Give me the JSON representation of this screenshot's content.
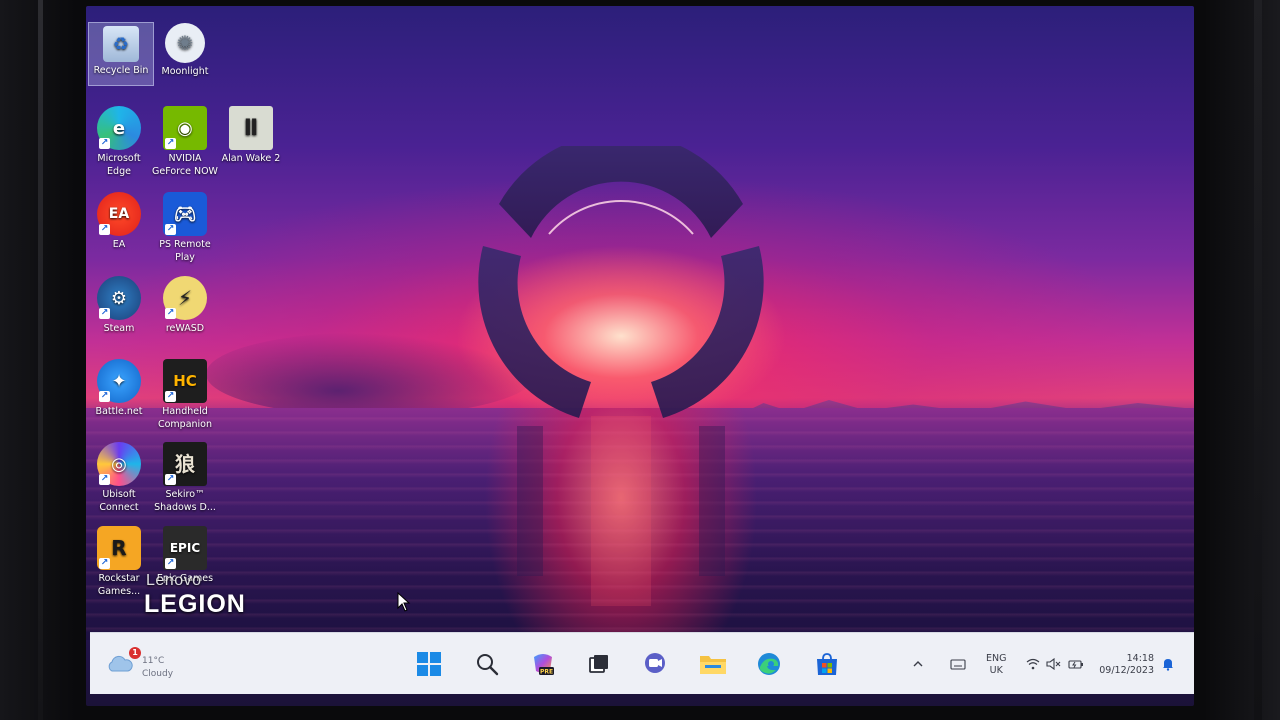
{
  "desktop": {
    "icons": [
      {
        "label": "Recycle Bin",
        "icon": "recycle-bin-icon"
      },
      {
        "label": "Moonlight",
        "icon": "moonlight-icon"
      },
      {
        "label": "Microsoft Edge",
        "icon": "edge-icon"
      },
      {
        "label": "NVIDIA GeForce NOW",
        "icon": "nvidia-icon"
      },
      {
        "label": "Alan Wake 2",
        "icon": "alan-wake-icon"
      },
      {
        "label": "EA",
        "icon": "ea-icon"
      },
      {
        "label": "PS Remote Play",
        "icon": "ps-remote-play-icon"
      },
      {
        "label": "Steam",
        "icon": "steam-icon"
      },
      {
        "label": "reWASD",
        "icon": "rewasd-icon"
      },
      {
        "label": "Battle.net",
        "icon": "battlenet-icon"
      },
      {
        "label": "Handheld Companion",
        "icon": "handheld-companion-icon"
      },
      {
        "label": "Ubisoft Connect",
        "icon": "ubisoft-icon"
      },
      {
        "label": "Sekiro™ Shadows D...",
        "icon": "sekiro-icon"
      },
      {
        "label": "Rockstar Games...",
        "icon": "rockstar-icon"
      },
      {
        "label": "Epic Games",
        "icon": "epic-games-icon"
      }
    ],
    "watermark": {
      "brand": "Lenovo",
      "product": "LEGION"
    }
  },
  "taskbar": {
    "weather": {
      "temp": "11°C",
      "condition": "Cloudy",
      "badge": "1"
    },
    "apps": [
      {
        "name": "start",
        "icon": "windows-start-icon"
      },
      {
        "name": "search",
        "icon": "search-icon"
      },
      {
        "name": "copilot",
        "icon": "copilot-icon",
        "badge": "PRE"
      },
      {
        "name": "task-view",
        "icon": "task-view-icon"
      },
      {
        "name": "teams",
        "icon": "teams-chat-icon"
      },
      {
        "name": "file-explorer",
        "icon": "folder-icon"
      },
      {
        "name": "edge",
        "icon": "edge-icon"
      },
      {
        "name": "store",
        "icon": "microsoft-store-icon"
      }
    ],
    "tray": {
      "language_line1": "ENG",
      "language_line2": "UK",
      "time": "14:18",
      "date": "09/12/2023"
    }
  },
  "colors": {
    "taskbar_bg": "#eef0f6",
    "accent_blue": "#1b64d6",
    "sky_pink": "#e0407c",
    "sky_purple": "#4a2293"
  }
}
